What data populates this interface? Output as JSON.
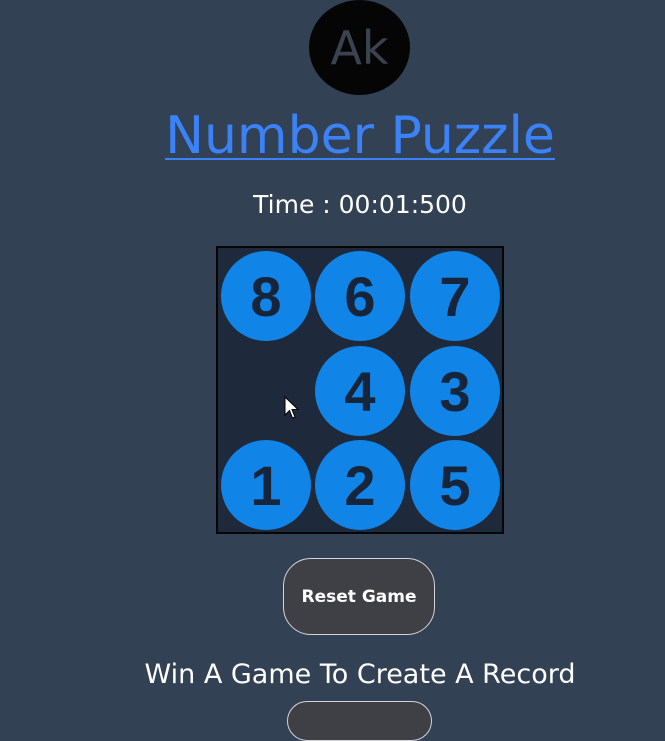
{
  "avatar": {
    "initials": "Ak"
  },
  "title": "Number Puzzle",
  "timer": "Time : 00:01:500",
  "board": {
    "rows": [
      [
        "8",
        "6",
        "7"
      ],
      [
        "",
        "4",
        "3"
      ],
      [
        "1",
        "2",
        "5"
      ]
    ]
  },
  "reset_label": "Reset Game",
  "record_text": "Win A Game To Create A Record",
  "colors": {
    "background": "#334155",
    "board": "#1e293b",
    "tile": "#1184e8",
    "tile_text": "#17253a",
    "title_link": "#3b82f6"
  }
}
